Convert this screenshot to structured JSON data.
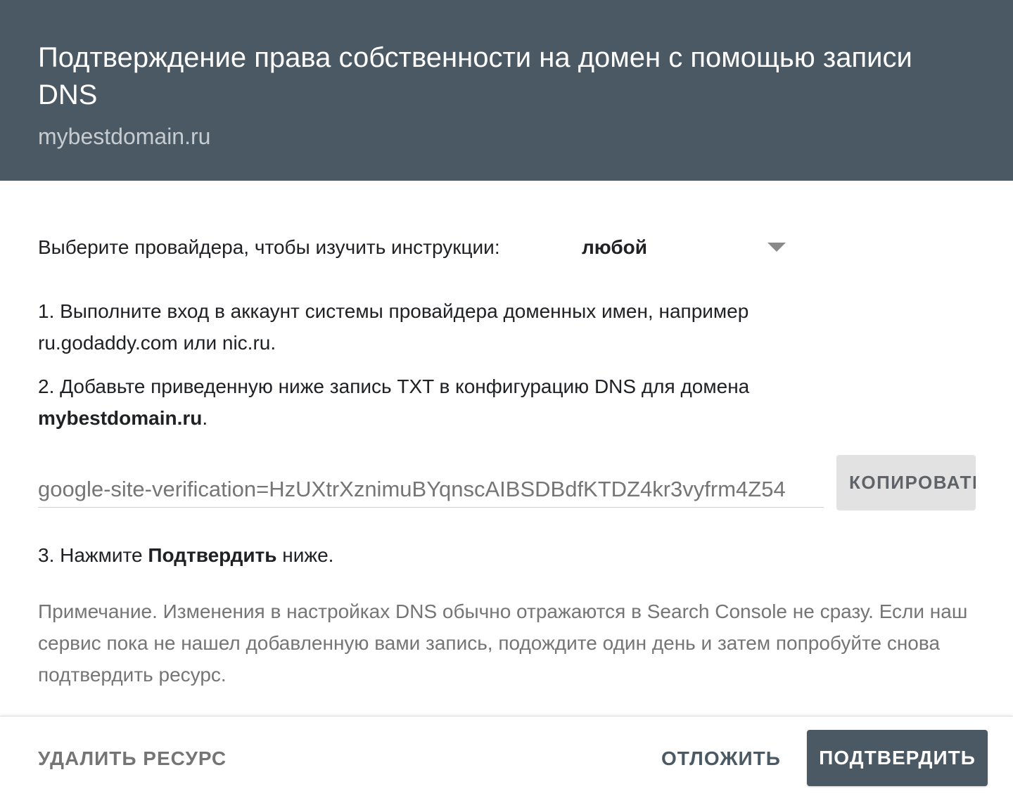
{
  "header": {
    "title": "Подтверждение права собственности на домен с помощью записи DNS",
    "domain": "mybestdomain.ru"
  },
  "provider": {
    "label": "Выберите провайдера, чтобы изучить инструкции:",
    "selected": "любой"
  },
  "steps": {
    "step1": "1. Выполните вход в аккаунт системы провайдера доменных имен, например ru.godaddy.com или nic.ru.",
    "step2_prefix": "2. Добавьте приведенную ниже запись TXT в конфигурацию DNS для домена ",
    "step2_domain": "mybestdomain.ru",
    "step2_suffix": ".",
    "step3_prefix": "3. Нажмите ",
    "step3_bold": "Подтвердить",
    "step3_suffix": " ниже."
  },
  "txt_record": {
    "value": "google-site-verification=HzUXtrXznimuBYqnscAIBSDBdfKTDZ4kr3vyfrm4Z54",
    "copy_label": "КОПИРОВАТЬ"
  },
  "note": "Примечание. Изменения в настройках DNS обычно отражаются в Search Console не сразу. Если наш сервис пока не нашел добавленную вами запись, подождите один день и затем попробуйте снова подтвердить ресурс.",
  "footer": {
    "delete_label": "УДАЛИТЬ РЕСУРС",
    "later_label": "ОТЛОЖИТЬ",
    "verify_label": "ПОДТВЕРДИТЬ"
  },
  "colors": {
    "header_bg": "#4a5964",
    "primary_button": "#4a5964",
    "copy_button_bg": "#e2e2e2"
  }
}
